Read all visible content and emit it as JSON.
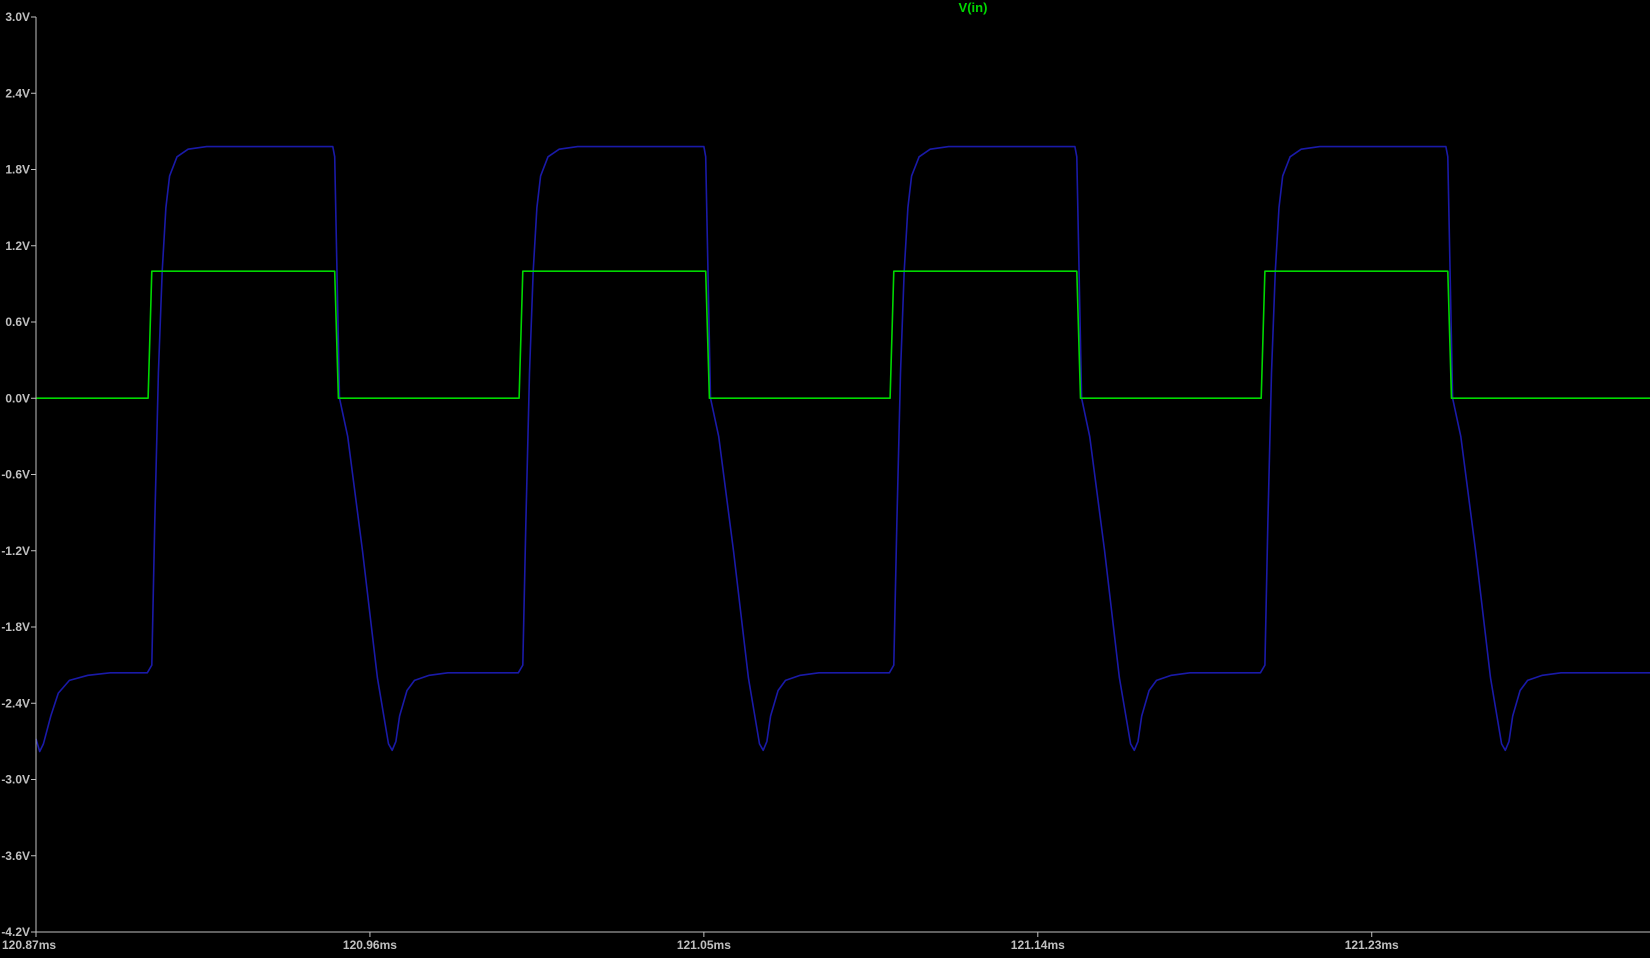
{
  "chart_data": {
    "type": "line",
    "title": "",
    "xlabel": "",
    "ylabel": "",
    "grid": false,
    "legend": "top-center",
    "xlim": [
      120.87,
      121.305
    ],
    "ylim": [
      -4.2,
      3.0
    ],
    "x_ticks": [
      "120.87ms",
      "120.96ms",
      "121.05ms",
      "121.14ms",
      "121.23ms"
    ],
    "x_tick_values": [
      120.87,
      120.96,
      121.05,
      121.14,
      121.23
    ],
    "y_ticks": [
      "3.0V",
      "2.4V",
      "1.8V",
      "1.2V",
      "0.6V",
      "0.0V",
      "-0.6V",
      "-1.2V",
      "-1.8V",
      "-2.4V",
      "-3.0V",
      "-3.6V",
      "-4.2V"
    ],
    "y_tick_values": [
      3.0,
      2.4,
      1.8,
      1.2,
      0.6,
      0.0,
      -0.6,
      -1.2,
      -1.8,
      -2.4,
      -3.0,
      -3.6,
      -4.2
    ],
    "series": [
      {
        "name": "V(in)",
        "color": "#00d800",
        "x": [
          120.87,
          120.9002,
          120.9012,
          120.9505,
          120.9515,
          121.0002,
          121.0012,
          121.0505,
          121.0515,
          121.1002,
          121.1012,
          121.1505,
          121.1515,
          121.2002,
          121.2012,
          121.2505,
          121.2515,
          121.305
        ],
        "y": [
          0.0,
          0.0,
          1.0,
          1.0,
          0.0,
          0.0,
          1.0,
          1.0,
          0.0,
          0.0,
          1.0,
          1.0,
          0.0,
          0.0,
          1.0,
          1.0,
          0.0,
          0.0
        ]
      },
      {
        "color": "#1a1aa8",
        "x": [
          120.87,
          120.871,
          120.872,
          120.874,
          120.876,
          120.879,
          120.884,
          120.89,
          120.9,
          120.9012,
          120.902,
          120.903,
          120.904,
          120.905,
          120.906,
          120.908,
          120.911,
          120.916,
          120.93,
          120.95,
          120.9505,
          120.9518,
          120.954,
          120.958,
          120.962,
          120.965,
          120.966,
          120.967,
          120.968,
          120.97,
          120.972,
          120.976,
          120.981,
          120.988,
          121.0,
          121.0012,
          121.002,
          121.003,
          121.004,
          121.005,
          121.006,
          121.008,
          121.011,
          121.016,
          121.03,
          121.05,
          121.0505,
          121.0518,
          121.054,
          121.058,
          121.062,
          121.065,
          121.066,
          121.067,
          121.068,
          121.07,
          121.072,
          121.076,
          121.081,
          121.088,
          121.1,
          121.1012,
          121.102,
          121.103,
          121.104,
          121.105,
          121.106,
          121.108,
          121.111,
          121.116,
          121.13,
          121.15,
          121.1505,
          121.1518,
          121.154,
          121.158,
          121.162,
          121.165,
          121.166,
          121.167,
          121.168,
          121.17,
          121.172,
          121.176,
          121.181,
          121.188,
          121.2,
          121.2012,
          121.202,
          121.203,
          121.204,
          121.205,
          121.206,
          121.208,
          121.211,
          121.216,
          121.23,
          121.25,
          121.2505,
          121.2518,
          121.254,
          121.258,
          121.262,
          121.265,
          121.266,
          121.267,
          121.268,
          121.27,
          121.272,
          121.276,
          121.281,
          121.288,
          121.305
        ],
        "y": [
          -2.68,
          -2.78,
          -2.72,
          -2.5,
          -2.32,
          -2.22,
          -2.18,
          -2.16,
          -2.16,
          -2.1,
          -1.0,
          0.2,
          1.0,
          1.5,
          1.75,
          1.9,
          1.96,
          1.98,
          1.98,
          1.98,
          1.9,
          0.0,
          -0.3,
          -1.2,
          -2.2,
          -2.72,
          -2.77,
          -2.7,
          -2.5,
          -2.3,
          -2.22,
          -2.18,
          -2.16,
          -2.16,
          -2.16,
          -2.1,
          -1.0,
          0.2,
          1.0,
          1.5,
          1.75,
          1.9,
          1.96,
          1.98,
          1.98,
          1.98,
          1.9,
          0.0,
          -0.3,
          -1.2,
          -2.2,
          -2.72,
          -2.77,
          -2.7,
          -2.5,
          -2.3,
          -2.22,
          -2.18,
          -2.16,
          -2.16,
          -2.16,
          -2.1,
          -1.0,
          0.2,
          1.0,
          1.5,
          1.75,
          1.9,
          1.96,
          1.98,
          1.98,
          1.98,
          1.9,
          0.0,
          -0.3,
          -1.2,
          -2.2,
          -2.72,
          -2.77,
          -2.7,
          -2.5,
          -2.3,
          -2.22,
          -2.18,
          -2.16,
          -2.16,
          -2.16,
          -2.1,
          -1.0,
          0.2,
          1.0,
          1.5,
          1.75,
          1.9,
          1.96,
          1.98,
          1.98,
          1.98,
          1.9,
          0.0,
          -0.3,
          -1.2,
          -2.2,
          -2.72,
          -2.77,
          -2.7,
          -2.5,
          -2.3,
          -2.22,
          -2.18,
          -2.16,
          -2.16,
          -2.16
        ]
      }
    ]
  },
  "colors": {
    "background": "#000000",
    "axis": "#c0c0c0"
  }
}
